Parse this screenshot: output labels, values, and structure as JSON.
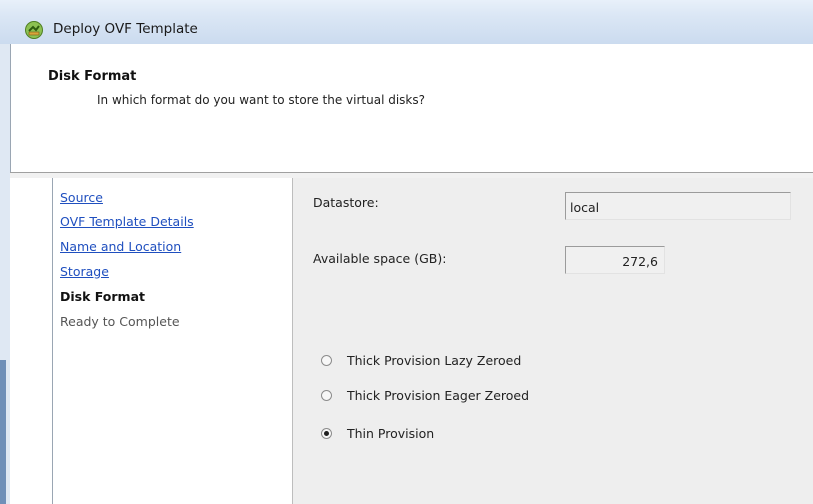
{
  "window": {
    "title": "Deploy OVF Template",
    "icon": "deploy-ovf-icon"
  },
  "header": {
    "title": "Disk Format",
    "subtitle": "In which format do you want to store the virtual disks?"
  },
  "nav": {
    "items": [
      {
        "label": "Source",
        "state": "link"
      },
      {
        "label": "OVF Template Details",
        "state": "link"
      },
      {
        "label": "Name and Location",
        "state": "link"
      },
      {
        "label": "Storage",
        "state": "link"
      },
      {
        "label": "Disk Format",
        "state": "current"
      },
      {
        "label": "Ready to Complete",
        "state": "disabled"
      }
    ]
  },
  "form": {
    "datastore_label": "Datastore:",
    "datastore_value": "local",
    "available_label": "Available space (GB):",
    "available_value": "272,6",
    "options": [
      {
        "label": "Thick Provision Lazy Zeroed",
        "selected": false
      },
      {
        "label": "Thick Provision Eager Zeroed",
        "selected": false
      },
      {
        "label": "Thin Provision",
        "selected": true
      }
    ]
  },
  "colors": {
    "link": "#1f4fbf",
    "content_bg": "#eeeeee",
    "titlebar": "#dbe7f5"
  }
}
